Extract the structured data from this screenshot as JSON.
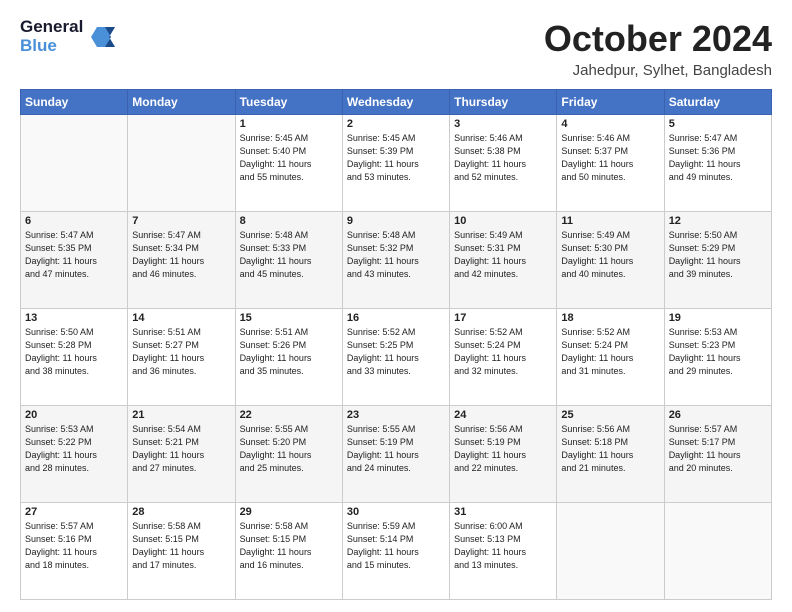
{
  "logo": {
    "line1": "General",
    "line2": "Blue"
  },
  "header": {
    "month": "October 2024",
    "location": "Jahedpur, Sylhet, Bangladesh"
  },
  "weekdays": [
    "Sunday",
    "Monday",
    "Tuesday",
    "Wednesday",
    "Thursday",
    "Friday",
    "Saturday"
  ],
  "weeks": [
    [
      {
        "day": "",
        "info": ""
      },
      {
        "day": "",
        "info": ""
      },
      {
        "day": "1",
        "info": "Sunrise: 5:45 AM\nSunset: 5:40 PM\nDaylight: 11 hours\nand 55 minutes."
      },
      {
        "day": "2",
        "info": "Sunrise: 5:45 AM\nSunset: 5:39 PM\nDaylight: 11 hours\nand 53 minutes."
      },
      {
        "day": "3",
        "info": "Sunrise: 5:46 AM\nSunset: 5:38 PM\nDaylight: 11 hours\nand 52 minutes."
      },
      {
        "day": "4",
        "info": "Sunrise: 5:46 AM\nSunset: 5:37 PM\nDaylight: 11 hours\nand 50 minutes."
      },
      {
        "day": "5",
        "info": "Sunrise: 5:47 AM\nSunset: 5:36 PM\nDaylight: 11 hours\nand 49 minutes."
      }
    ],
    [
      {
        "day": "6",
        "info": "Sunrise: 5:47 AM\nSunset: 5:35 PM\nDaylight: 11 hours\nand 47 minutes."
      },
      {
        "day": "7",
        "info": "Sunrise: 5:47 AM\nSunset: 5:34 PM\nDaylight: 11 hours\nand 46 minutes."
      },
      {
        "day": "8",
        "info": "Sunrise: 5:48 AM\nSunset: 5:33 PM\nDaylight: 11 hours\nand 45 minutes."
      },
      {
        "day": "9",
        "info": "Sunrise: 5:48 AM\nSunset: 5:32 PM\nDaylight: 11 hours\nand 43 minutes."
      },
      {
        "day": "10",
        "info": "Sunrise: 5:49 AM\nSunset: 5:31 PM\nDaylight: 11 hours\nand 42 minutes."
      },
      {
        "day": "11",
        "info": "Sunrise: 5:49 AM\nSunset: 5:30 PM\nDaylight: 11 hours\nand 40 minutes."
      },
      {
        "day": "12",
        "info": "Sunrise: 5:50 AM\nSunset: 5:29 PM\nDaylight: 11 hours\nand 39 minutes."
      }
    ],
    [
      {
        "day": "13",
        "info": "Sunrise: 5:50 AM\nSunset: 5:28 PM\nDaylight: 11 hours\nand 38 minutes."
      },
      {
        "day": "14",
        "info": "Sunrise: 5:51 AM\nSunset: 5:27 PM\nDaylight: 11 hours\nand 36 minutes."
      },
      {
        "day": "15",
        "info": "Sunrise: 5:51 AM\nSunset: 5:26 PM\nDaylight: 11 hours\nand 35 minutes."
      },
      {
        "day": "16",
        "info": "Sunrise: 5:52 AM\nSunset: 5:25 PM\nDaylight: 11 hours\nand 33 minutes."
      },
      {
        "day": "17",
        "info": "Sunrise: 5:52 AM\nSunset: 5:24 PM\nDaylight: 11 hours\nand 32 minutes."
      },
      {
        "day": "18",
        "info": "Sunrise: 5:52 AM\nSunset: 5:24 PM\nDaylight: 11 hours\nand 31 minutes."
      },
      {
        "day": "19",
        "info": "Sunrise: 5:53 AM\nSunset: 5:23 PM\nDaylight: 11 hours\nand 29 minutes."
      }
    ],
    [
      {
        "day": "20",
        "info": "Sunrise: 5:53 AM\nSunset: 5:22 PM\nDaylight: 11 hours\nand 28 minutes."
      },
      {
        "day": "21",
        "info": "Sunrise: 5:54 AM\nSunset: 5:21 PM\nDaylight: 11 hours\nand 27 minutes."
      },
      {
        "day": "22",
        "info": "Sunrise: 5:55 AM\nSunset: 5:20 PM\nDaylight: 11 hours\nand 25 minutes."
      },
      {
        "day": "23",
        "info": "Sunrise: 5:55 AM\nSunset: 5:19 PM\nDaylight: 11 hours\nand 24 minutes."
      },
      {
        "day": "24",
        "info": "Sunrise: 5:56 AM\nSunset: 5:19 PM\nDaylight: 11 hours\nand 22 minutes."
      },
      {
        "day": "25",
        "info": "Sunrise: 5:56 AM\nSunset: 5:18 PM\nDaylight: 11 hours\nand 21 minutes."
      },
      {
        "day": "26",
        "info": "Sunrise: 5:57 AM\nSunset: 5:17 PM\nDaylight: 11 hours\nand 20 minutes."
      }
    ],
    [
      {
        "day": "27",
        "info": "Sunrise: 5:57 AM\nSunset: 5:16 PM\nDaylight: 11 hours\nand 18 minutes."
      },
      {
        "day": "28",
        "info": "Sunrise: 5:58 AM\nSunset: 5:15 PM\nDaylight: 11 hours\nand 17 minutes."
      },
      {
        "day": "29",
        "info": "Sunrise: 5:58 AM\nSunset: 5:15 PM\nDaylight: 11 hours\nand 16 minutes."
      },
      {
        "day": "30",
        "info": "Sunrise: 5:59 AM\nSunset: 5:14 PM\nDaylight: 11 hours\nand 15 minutes."
      },
      {
        "day": "31",
        "info": "Sunrise: 6:00 AM\nSunset: 5:13 PM\nDaylight: 11 hours\nand 13 minutes."
      },
      {
        "day": "",
        "info": ""
      },
      {
        "day": "",
        "info": ""
      }
    ]
  ]
}
